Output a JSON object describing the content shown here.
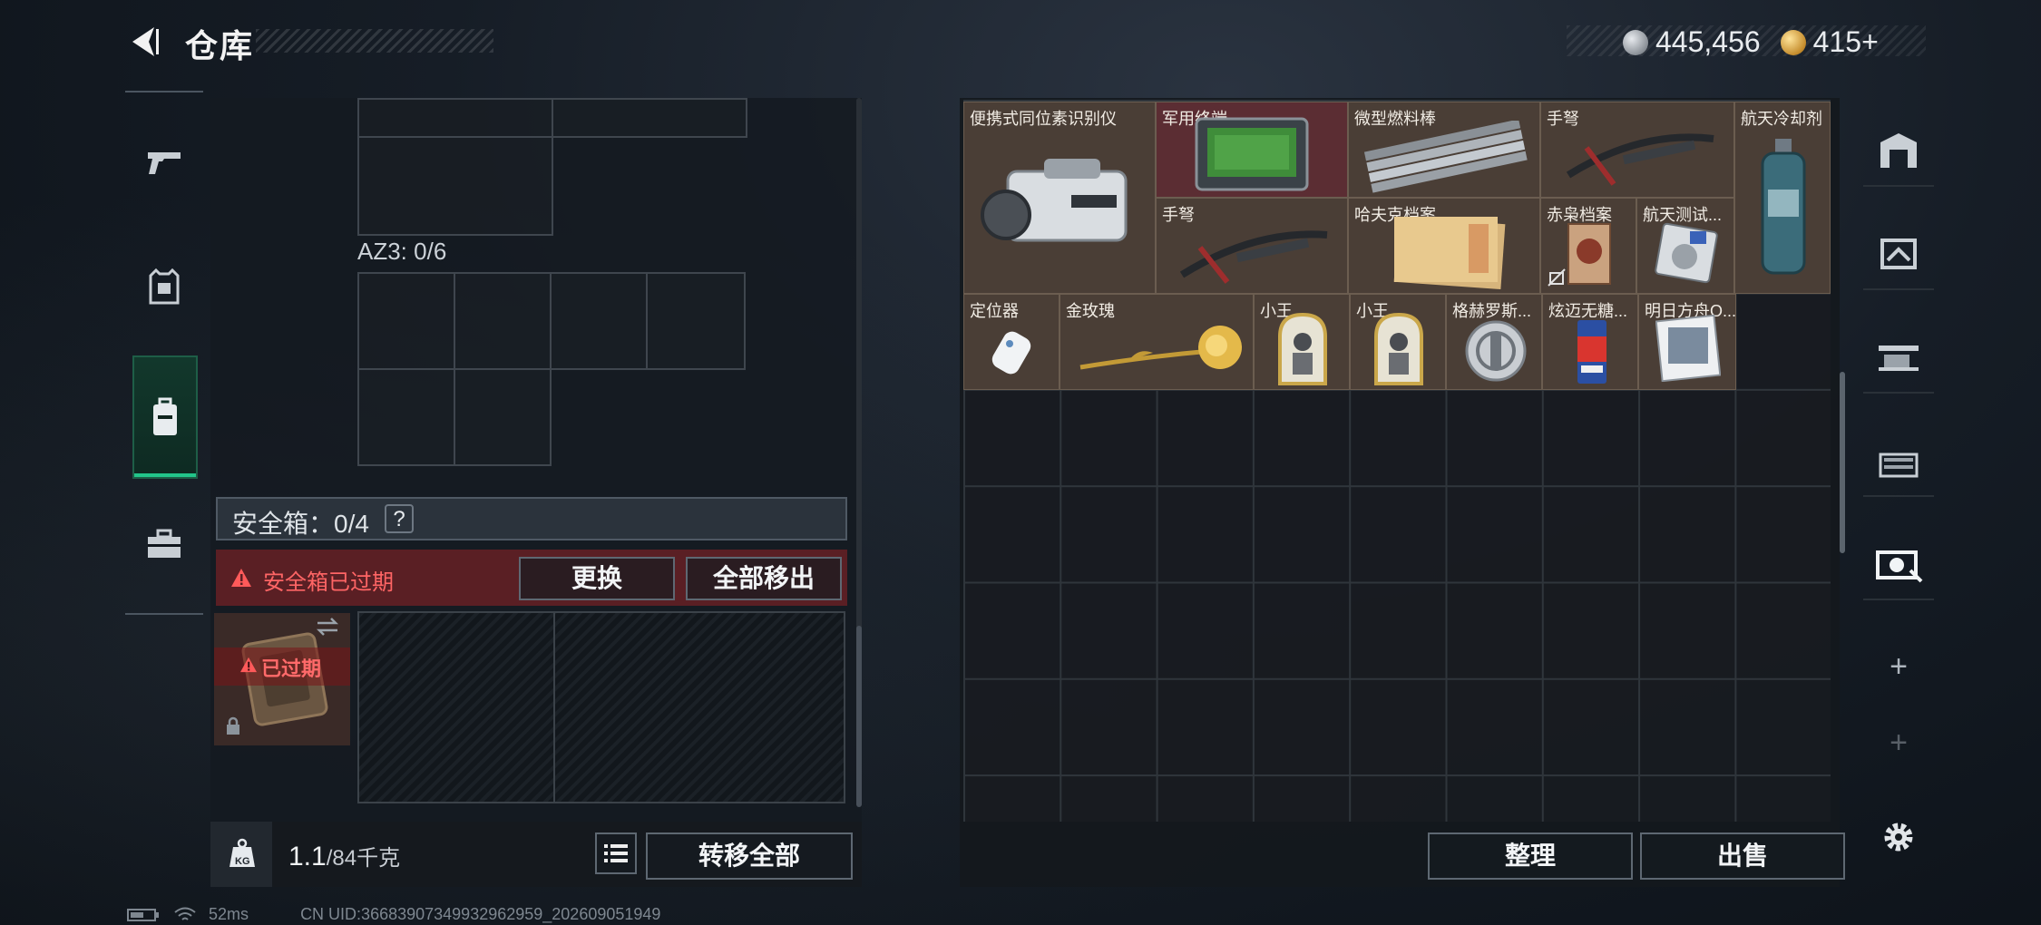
{
  "header": {
    "title": "仓库",
    "currencies": [
      {
        "icon": "silver-coin-icon",
        "value": "445,456"
      },
      {
        "icon": "gold-coin-icon",
        "value": "415+"
      }
    ]
  },
  "left_nav": {
    "items": [
      {
        "name": "pistol-icon"
      },
      {
        "name": "armor-icon"
      },
      {
        "name": "backpack-icon",
        "active": true
      },
      {
        "name": "toolbox-icon"
      }
    ]
  },
  "loadout": {
    "az3_label": "AZ3: 0/6",
    "safebox_label": "安全箱：0/4",
    "help": "?",
    "expired_warning": "安全箱已过期",
    "replace_button": "更换",
    "remove_all_button": "全部移出",
    "slot_expired": "已过期",
    "weight_value": "1.1",
    "weight_capacity": "/84千克",
    "weight_icon": "KG",
    "transfer_all_button": "转移全部"
  },
  "storage": {
    "items": [
      {
        "label": "便携式同位素识别仪",
        "style": "brown"
      },
      {
        "label": "军用终端",
        "style": "red"
      },
      {
        "label": "微型燃料棒",
        "style": "brown"
      },
      {
        "label": "手弩",
        "style": "brown"
      },
      {
        "label": "航天冷却剂",
        "style": "brown"
      },
      {
        "label": "手弩",
        "style": "brown"
      },
      {
        "label": "哈夫克档案",
        "style": "brown"
      },
      {
        "label": "赤枭档案",
        "style": "brown"
      },
      {
        "label": "航天测试...",
        "style": "brown"
      },
      {
        "label": "定位器",
        "style": "brown"
      },
      {
        "label": "金玫瑰",
        "style": "brown"
      },
      {
        "label": "小王",
        "style": "brown"
      },
      {
        "label": "小王",
        "style": "brown"
      },
      {
        "label": "格赫罗斯...",
        "style": "brown"
      },
      {
        "label": "炫迈无糖...",
        "style": "brown"
      },
      {
        "label": "明日方舟O...",
        "style": "brown"
      }
    ],
    "sort_button": "整理",
    "sell_button": "出售"
  },
  "right_nav": {
    "items": [
      "warehouse-icon",
      "shelf-1-icon",
      "shelf-3-icon",
      "shelf-4-icon",
      "shelf-active-icon",
      "plus-icon",
      "plus-icon",
      "gear-icon"
    ],
    "plus": "+"
  },
  "status_bar": {
    "ping": "52ms",
    "uid": "CN UID:36683907349932962959_202609051949"
  },
  "colors": {
    "accent_green": "#22c58a",
    "warning_red": "#ff6565",
    "item_brown": "#4a3e36",
    "item_red": "#5b2d33"
  }
}
